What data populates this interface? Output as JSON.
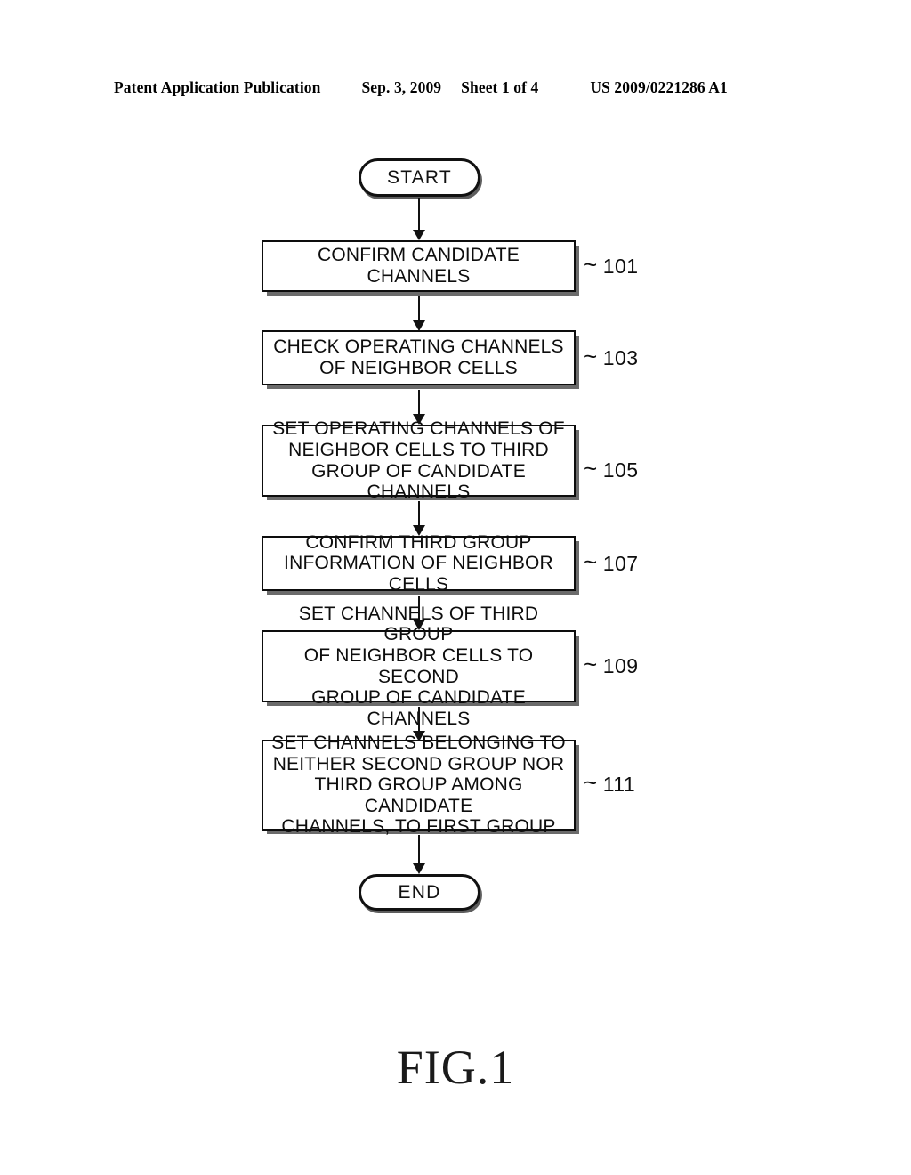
{
  "header": {
    "publication": "Patent Application Publication",
    "date": "Sep. 3, 2009",
    "sheet": "Sheet 1 of 4",
    "document_number": "US 2009/0221286 A1"
  },
  "figure": {
    "caption": "FIG.1"
  },
  "flowchart": {
    "start_label": "START",
    "end_label": "END",
    "steps": [
      {
        "ref": "101",
        "tilde": "~",
        "text": "CONFIRM CANDIDATE CHANNELS"
      },
      {
        "ref": "103",
        "tilde": "~",
        "text": "CHECK OPERATING CHANNELS\nOF NEIGHBOR CELLS"
      },
      {
        "ref": "105",
        "tilde": "~",
        "text": "SET OPERATING CHANNELS OF\nNEIGHBOR CELLS TO THIRD\nGROUP OF CANDIDATE CHANNELS"
      },
      {
        "ref": "107",
        "tilde": "~",
        "text": "CONFIRM THIRD GROUP\nINFORMATION OF NEIGHBOR CELLS"
      },
      {
        "ref": "109",
        "tilde": "~",
        "text": "SET CHANNELS OF THIRD GROUP\nOF NEIGHBOR CELLS TO SECOND\nGROUP OF CANDIDATE CHANNELS"
      },
      {
        "ref": "111",
        "tilde": "~",
        "text": "SET CHANNELS BELONGING TO\nNEITHER SECOND GROUP NOR\nTHIRD GROUP AMONG CANDIDATE\nCHANNELS, TO FIRST GROUP"
      }
    ]
  },
  "colors": {
    "ink": "#0d0d0d",
    "shadow": "#6b6b6b",
    "paper": "#ffffff"
  }
}
